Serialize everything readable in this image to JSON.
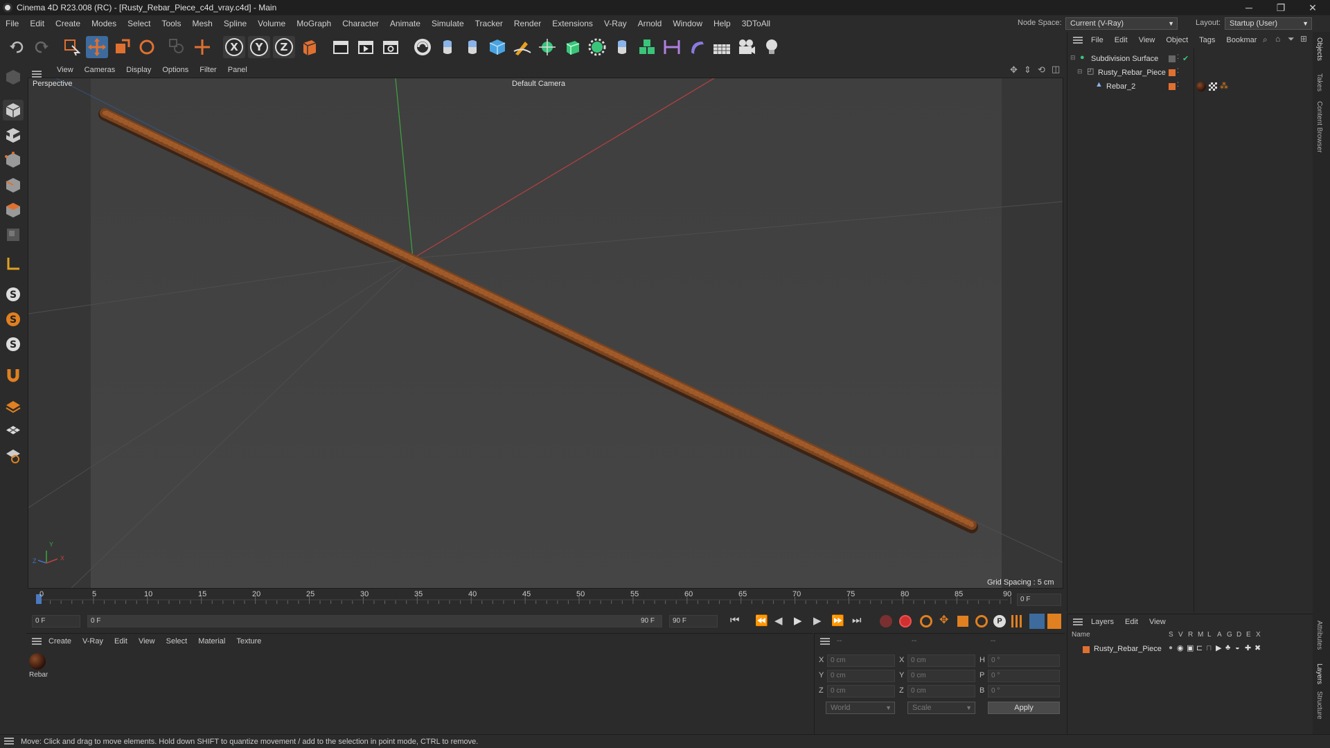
{
  "window": {
    "title": "Cinema 4D R23.008 (RC) - [Rusty_Rebar_Piece_c4d_vray.c4d] - Main",
    "minimize": "─",
    "restore": "❐",
    "close": "✕"
  },
  "menubar": {
    "items": [
      "File",
      "Edit",
      "Create",
      "Modes",
      "Select",
      "Tools",
      "Mesh",
      "Spline",
      "Volume",
      "MoGraph",
      "Character",
      "Animate",
      "Simulate",
      "Tracker",
      "Render",
      "Extensions",
      "V-Ray",
      "Arnold",
      "Window",
      "Help",
      "3DToAll"
    ],
    "node_space_label": "Node Space:",
    "node_space_value": "Current (V-Ray)",
    "layout_label": "Layout:",
    "layout_value": "Startup (User)"
  },
  "viewport": {
    "menu": [
      "View",
      "Cameras",
      "Display",
      "Options",
      "Filter",
      "Panel"
    ],
    "view_name": "Perspective",
    "camera": "Default Camera",
    "grid_spacing": "Grid Spacing : 5 cm",
    "axis_y": "Y",
    "axis_x": "X",
    "axis_z": "Z"
  },
  "timeline": {
    "ticks": [
      "0",
      "5",
      "10",
      "15",
      "20",
      "25",
      "30",
      "35",
      "40",
      "45",
      "50",
      "55",
      "60",
      "65",
      "70",
      "75",
      "80",
      "85",
      "90"
    ],
    "current_frame_right": "0 F",
    "start_frame": "0 F",
    "range_start": "0 F",
    "range_end": "90 F",
    "end_frame": "90 F"
  },
  "material_panel": {
    "menu": [
      "Create",
      "V-Ray",
      "Edit",
      "View",
      "Select",
      "Material",
      "Texture"
    ],
    "material_name": "Rebar"
  },
  "coords_panel": {
    "header_dashes": [
      "--",
      "--",
      "--"
    ],
    "rows": [
      {
        "a": "X",
        "av": "0 cm",
        "b": "X",
        "bv": "0 cm",
        "c": "H",
        "cv": "0 °"
      },
      {
        "a": "Y",
        "av": "0 cm",
        "b": "Y",
        "bv": "0 cm",
        "c": "P",
        "cv": "0 °"
      },
      {
        "a": "Z",
        "av": "0 cm",
        "b": "Z",
        "bv": "0 cm",
        "c": "B",
        "cv": "0 °"
      }
    ],
    "world": "World",
    "scale": "Scale",
    "apply": "Apply"
  },
  "objects_panel": {
    "menu": [
      "File",
      "Edit",
      "View",
      "Object",
      "Tags",
      "Bookmar"
    ],
    "items": [
      {
        "name": "Subdivision Surface"
      },
      {
        "name": "Rusty_Rebar_Piece"
      },
      {
        "name": "Rebar_2"
      }
    ]
  },
  "layers_panel": {
    "menu": [
      "Layers",
      "Edit",
      "View"
    ],
    "columns": [
      "Name",
      "S",
      "V",
      "R",
      "M",
      "L",
      "A",
      "G",
      "D",
      "E",
      "X"
    ],
    "layer_name": "Rusty_Rebar_Piece"
  },
  "side_tabs": [
    "Objects",
    "Takes",
    "Content Browser",
    "Attributes",
    "Layers",
    "Structure"
  ],
  "status": "Move: Click and drag to move elements. Hold down SHIFT to quantize movement / add to the selection in point mode, CTRL to remove.",
  "colors": {
    "accent": "#e07030",
    "active_blue": "#3d6b9e",
    "rebar": "#7a4420"
  },
  "toolbar_icons": [
    "undo-icon",
    "redo-icon",
    "live-select-icon",
    "move-icon",
    "scale-icon",
    "rotate-icon",
    "select-last-icon",
    "add-icon",
    "x-axis-icon",
    "y-axis-icon",
    "z-axis-icon",
    "coordinate-system-icon",
    "render-region-icon",
    "render-view-icon",
    "render-settings-icon"
  ]
}
